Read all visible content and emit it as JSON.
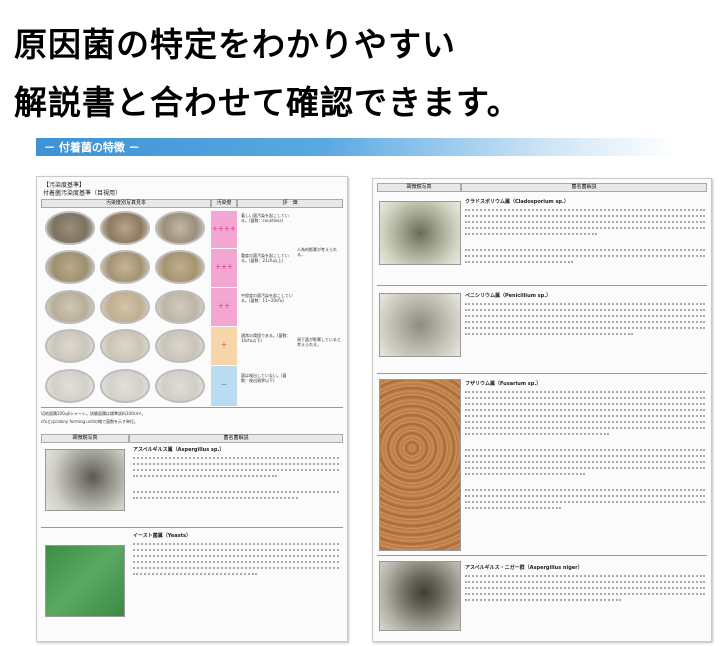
{
  "headline": {
    "line1": "原因菌の特定をわかりやすい",
    "line2": "解説書と合わせて確認できます。"
  },
  "section": {
    "title": "－ 付着菌の特徴 －"
  },
  "left_doc": {
    "label": "【汚染度基準】",
    "sublabel": "付着菌汚染度基準（目視用）",
    "table_headers": [
      "汚染度別写真見本",
      "汚染度",
      "評　価"
    ],
    "rows": [
      {
        "level": "＋＋＋＋",
        "desc": "著しい菌汚染を起こしている。(菌数：countless)",
        "color": "#f4a6d2"
      },
      {
        "level": "＋＋＋",
        "desc": "重度の菌汚染を起こしている。(菌数：21cfu以上)",
        "color": "#f4a6d2"
      },
      {
        "level": "＋＋",
        "desc": "中程度の菌汚染を起こしている。(菌数：11~20cfu)",
        "color": "#f4a6d2"
      },
      {
        "level": "＋",
        "desc": "通常の環境である。(菌数：10cfu以下)",
        "color": "#f6d6a8"
      },
      {
        "level": "－",
        "desc": "菌は検出していない。(菌数：検出限界以下)",
        "color": "#b9dcf2"
      }
    ],
    "evaluation_top": "人為的影響が考えられる。",
    "evaluation_bottom": "現下菌が影響していると考えられる。",
    "note1": "培地面積100㎠/シャーレ。試験面積は標準試料100cm²。",
    "note2": "cfuとはcolony forming unitの略で菌数を示す単位。",
    "table2_headers": [
      "顕微鏡写真",
      "菌名菌解説"
    ],
    "aspergillus_title": "アスペルギルス属（Aspergillus sp.）",
    "yeast_title": "イースト菌属（Yeasts）"
  },
  "right_doc": {
    "headers": [
      "顕微鏡写真",
      "菌名菌解説"
    ],
    "entries": [
      {
        "title": "クラドスポリウム属（Cladosporium sp.）"
      },
      {
        "title": "ペニシリウム属（Penicillium sp.）"
      },
      {
        "title": "フザリウム属（Fusarium sp.）"
      },
      {
        "title": "アスペルギルス・ニガー群（Aspergillus niger）"
      }
    ]
  }
}
